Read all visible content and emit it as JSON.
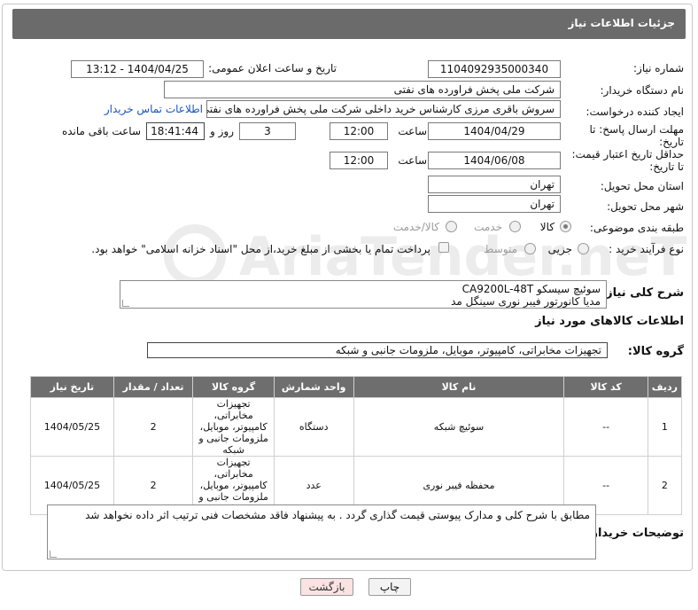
{
  "header": {
    "title": "جزئیات اطلاعات نیاز"
  },
  "fields": {
    "need_number_label": "شماره نیاز:",
    "need_number": "1104092935000340",
    "announce_label": "تاریخ و ساعت اعلان عمومی:",
    "announce_value": "1404/04/25 - 13:12",
    "buyer_org_label": "نام دستگاه خریدار:",
    "buyer_org": "شرکت ملی پخش فراورده های نفتی",
    "creator_label": "ایجاد کننده درخواست:",
    "creator": "سروش باقری مرزی کارشناس خرید داخلی شرکت ملی پخش فراورده های نفتی",
    "contact_link": "اطلاعات تماس خریدار",
    "deadline_label_1": "مهلت ارسال پاسخ: تا",
    "deadline_label_2": "تاریخ:",
    "deadline_date": "1404/04/29",
    "time_label": "ساعت",
    "deadline_time": "12:00",
    "days_value": "3",
    "days_label": "روز و",
    "remaining_time": "18:41:44",
    "remaining_label": "ساعت باقی مانده",
    "validity_label_1": "حداقل تاریخ اعتبار قیمت:",
    "validity_label_2": "تا تاریخ:",
    "validity_date": "1404/06/08",
    "validity_time": "12:00",
    "province_label": "استان محل تحویل:",
    "province": "تهران",
    "city_label": "شهر محل تحویل:",
    "city": "تهران",
    "category_label": "طبقه بندی موضوعی:",
    "category_options": [
      "کالا",
      "خدمت",
      "کالا/خدمت"
    ],
    "category_selected": "کالا",
    "process_label": "نوع فرآیند خرید :",
    "process_options": [
      "جزیی",
      "متوسط"
    ],
    "payment_note": "پرداخت تمام یا بخشی از مبلغ خرید،از محل \"اسناد خزانه اسلامی\" خواهد بود."
  },
  "description": {
    "label": "شرح کلی نیاز:",
    "line1": "سوئیچ سیسکو CA9200L-48T",
    "line2": "مدیا کانورتور فیبر نوری سینگل مد"
  },
  "goods_info": {
    "title": "اطلاعات کالاهای مورد نیاز",
    "group_label": "گروه کالا:",
    "group_value": "تجهیزات مخابراتی، کامپیوتر، موبایل، ملزومات جانبی و شبکه"
  },
  "table": {
    "headers": [
      "ردیف",
      "کد کالا",
      "نام کالا",
      "واحد شمارش",
      "گروه کالا",
      "تعداد / مقدار",
      "تاریخ نیاز"
    ],
    "rows": [
      [
        "1",
        "--",
        "سوئیچ شبکه",
        "دستگاه",
        "تجهیزات مخابراتی، کامپیوتر، موبایل، ملزومات جانبی و شبکه",
        "2",
        "1404/05/25"
      ],
      [
        "2",
        "--",
        "محفظه فیبر نوری",
        "عدد",
        "تجهیزات مخابراتی، کامپیوتر، موبایل، ملزومات جانبی و شبکه",
        "2",
        "1404/05/25"
      ]
    ]
  },
  "buyer_notes": {
    "label": "توضیحات خریدار:",
    "text": "مطابق با شرح کلی و مدارک پیوستی قیمت گذاری گردد . به پیشنهاد فاقد مشخصات فنی ترتیب اثر داده نخواهد شد"
  },
  "buttons": {
    "print": "چاپ",
    "back": "بازگشت"
  },
  "watermark": {
    "text": "AriaTender.neT"
  },
  "colors": {
    "header_bg": "#6b6b6b",
    "link": "#1a56b8",
    "back_button_bg": "#fbe3e3"
  }
}
